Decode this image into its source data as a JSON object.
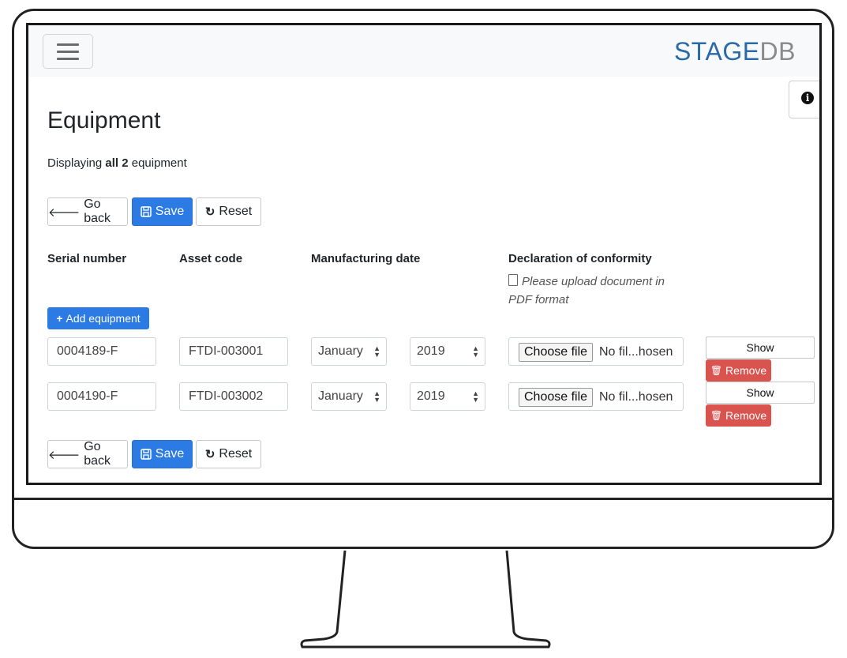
{
  "brand": {
    "part1": "STAGE",
    "part2": "DB"
  },
  "page": {
    "title": "Equipment",
    "summary_prefix": "Displaying ",
    "summary_bold": "all 2",
    "summary_suffix": " equipment"
  },
  "toolbar": {
    "go_back": "Go back",
    "save": "Save",
    "reset": "Reset"
  },
  "columns": {
    "serial": "Serial number",
    "asset": "Asset code",
    "manufacturing": "Manufacturing date",
    "declaration": "Declaration of conformity",
    "declaration_hint": "Please upload document in PDF format"
  },
  "add_equipment": "Add equipment",
  "rows": [
    {
      "serial": "0004189-F",
      "asset": "FTDI-003001",
      "month": "January",
      "year": "2019",
      "choose_file": "Choose file",
      "file_status": "No fil...hosen",
      "show": "Show",
      "remove": "Remove"
    },
    {
      "serial": "0004190-F",
      "asset": "FTDI-003002",
      "month": "January",
      "year": "2019",
      "choose_file": "Choose file",
      "file_status": "No fil...hosen",
      "show": "Show",
      "remove": "Remove"
    }
  ],
  "colors": {
    "primary": "#2c7be5",
    "danger": "#d9534f",
    "brand_blue": "#2b6aa8",
    "brand_gray": "#8a8a8a"
  },
  "icons": [
    "menu-icon",
    "info-icon",
    "arrow-left-icon",
    "floppy-disk-icon",
    "refresh-icon",
    "file-pdf-icon",
    "plus-icon",
    "trash-icon",
    "select-arrows-icon"
  ]
}
